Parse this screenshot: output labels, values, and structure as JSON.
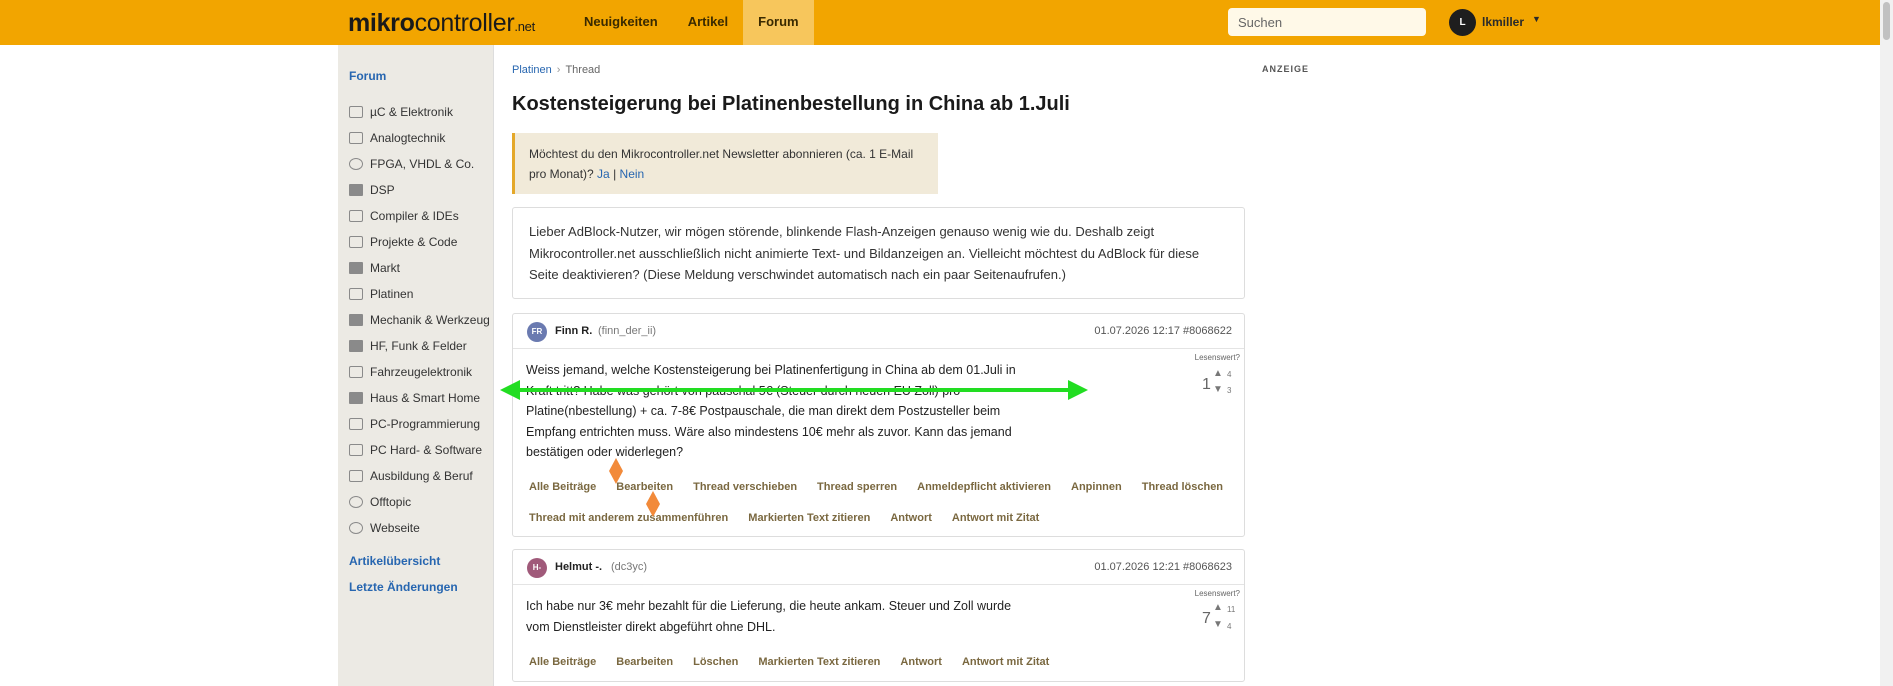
{
  "header": {
    "logo_bold": "mikro",
    "logo_rest": "controller",
    "logo_tld": ".net",
    "nav": [
      "Neuigkeiten",
      "Artikel",
      "Forum"
    ],
    "search_placeholder": "Suchen",
    "user_initial": "L",
    "username": "lkmiller"
  },
  "sidebar": {
    "heading": "Forum",
    "items": [
      {
        "label": "µC & Elektronik",
        "icon": "chip-icon"
      },
      {
        "label": "Analogtechnik",
        "icon": "analog-icon"
      },
      {
        "label": "FPGA, VHDL & Co.",
        "icon": "fpga-icon"
      },
      {
        "label": "DSP",
        "icon": "dsp-icon"
      },
      {
        "label": "Compiler & IDEs",
        "icon": "compiler-icon"
      },
      {
        "label": "Projekte & Code",
        "icon": "project-icon"
      },
      {
        "label": "Markt",
        "icon": "cart-icon"
      },
      {
        "label": "Platinen",
        "icon": "board-icon"
      },
      {
        "label": "Mechanik & Werkzeug",
        "icon": "wrench-icon"
      },
      {
        "label": "HF, Funk & Felder",
        "icon": "radio-icon"
      },
      {
        "label": "Fahrzeugelektronik",
        "icon": "car-icon"
      },
      {
        "label": "Haus & Smart Home",
        "icon": "home-icon"
      },
      {
        "label": "PC-Programmierung",
        "icon": "code-icon"
      },
      {
        "label": "PC Hard- & Software",
        "icon": "pc-icon"
      },
      {
        "label": "Ausbildung & Beruf",
        "icon": "book-icon"
      },
      {
        "label": "Offtopic",
        "icon": "chat-icon"
      },
      {
        "label": "Webseite",
        "icon": "globe-icon"
      }
    ],
    "links": [
      "Artikelübersicht",
      "Letzte Änderungen"
    ]
  },
  "breadcrumb": {
    "parent": "Platinen",
    "separator": "›",
    "current": "Thread"
  },
  "title": "Kostensteigerung bei Platinenbestellung in China ab 1.Juli",
  "anzeige": "ANZEIGE",
  "newsletter": {
    "text": "Möchtest du den Mikrocontroller.net Newsletter abonnieren (ca. 1 E-Mail pro Monat)?",
    "yes": "Ja",
    "sep": "|",
    "no": "Nein"
  },
  "adblock": "Lieber AdBlock-Nutzer, wir mögen störende, blinkende Flash-Anzeigen genauso wenig wie du. Deshalb zeigt Mikrocontroller.net ausschließlich nicht animierte Text- und Bildanzeigen an. Vielleicht möchtest du AdBlock für diese Seite deaktivieren? (Diese Meldung verschwindet automatisch nach ein paar Seitenaufrufen.)",
  "posts": [
    {
      "initials": "FR",
      "avatar_color": "#6a7ab0",
      "name": "Finn R.",
      "user": "(finn_der_ii)",
      "date": "01.07.2026 12:17",
      "id": "#8068622",
      "lines": [
        "Weiss jemand, welche Kostensteigerung bei Platinenfertigung in China ab dem 01.Juli in",
        "Kraft tritt? Habe was gehört von pauschal 5€ (Steuer durch neuen EU Zoll) pro",
        "Platine(nbestellung) + ca. 7-8€ Postpauschale, die man direkt dem Postzusteller beim",
        "Empfang entrichten muss. Wäre also mindestens 10€ mehr als zuvor. Kann das jemand",
        "bestätigen oder widerlegen?"
      ],
      "vote_label": "Lesenswert?",
      "score": "1",
      "up": "4",
      "down": "3",
      "actions_row1": [
        "Alle Beiträge",
        "Bearbeiten",
        "Thread verschieben",
        "Thread sperren",
        "Anmeldepflicht aktivieren",
        "Anpinnen",
        "Thread löschen"
      ],
      "actions_row2": [
        "Thread mit anderem zusammenführen",
        "Markierten Text zitieren",
        "Antwort",
        "Antwort mit Zitat"
      ]
    },
    {
      "initials": "H-",
      "avatar_color": "#a05a7a",
      "name": "Helmut -.",
      "user": "(dc3yc)",
      "date": "01.07.2026 12:21",
      "id": "#8068623",
      "lines": [
        "Ich habe nur 3€ mehr bezahlt für die Lieferung, die heute ankam. Steuer und Zoll wurde",
        "vom Dienstleister direkt abgeführt ohne DHL."
      ],
      "vote_label": "Lesenswert?",
      "score": "7",
      "up": "11",
      "down": "4",
      "actions_row1": [
        "Alle Beiträge",
        "Bearbeiten",
        "Löschen",
        "Markierten Text zitieren",
        "Antwort",
        "Antwort mit Zitat"
      ]
    }
  ],
  "colors": {
    "header": "#f2a500",
    "link": "#2766b0",
    "action": "#7a6840",
    "overlay_arrow": "#22dd22",
    "overlay_marker": "#f28a3a"
  }
}
